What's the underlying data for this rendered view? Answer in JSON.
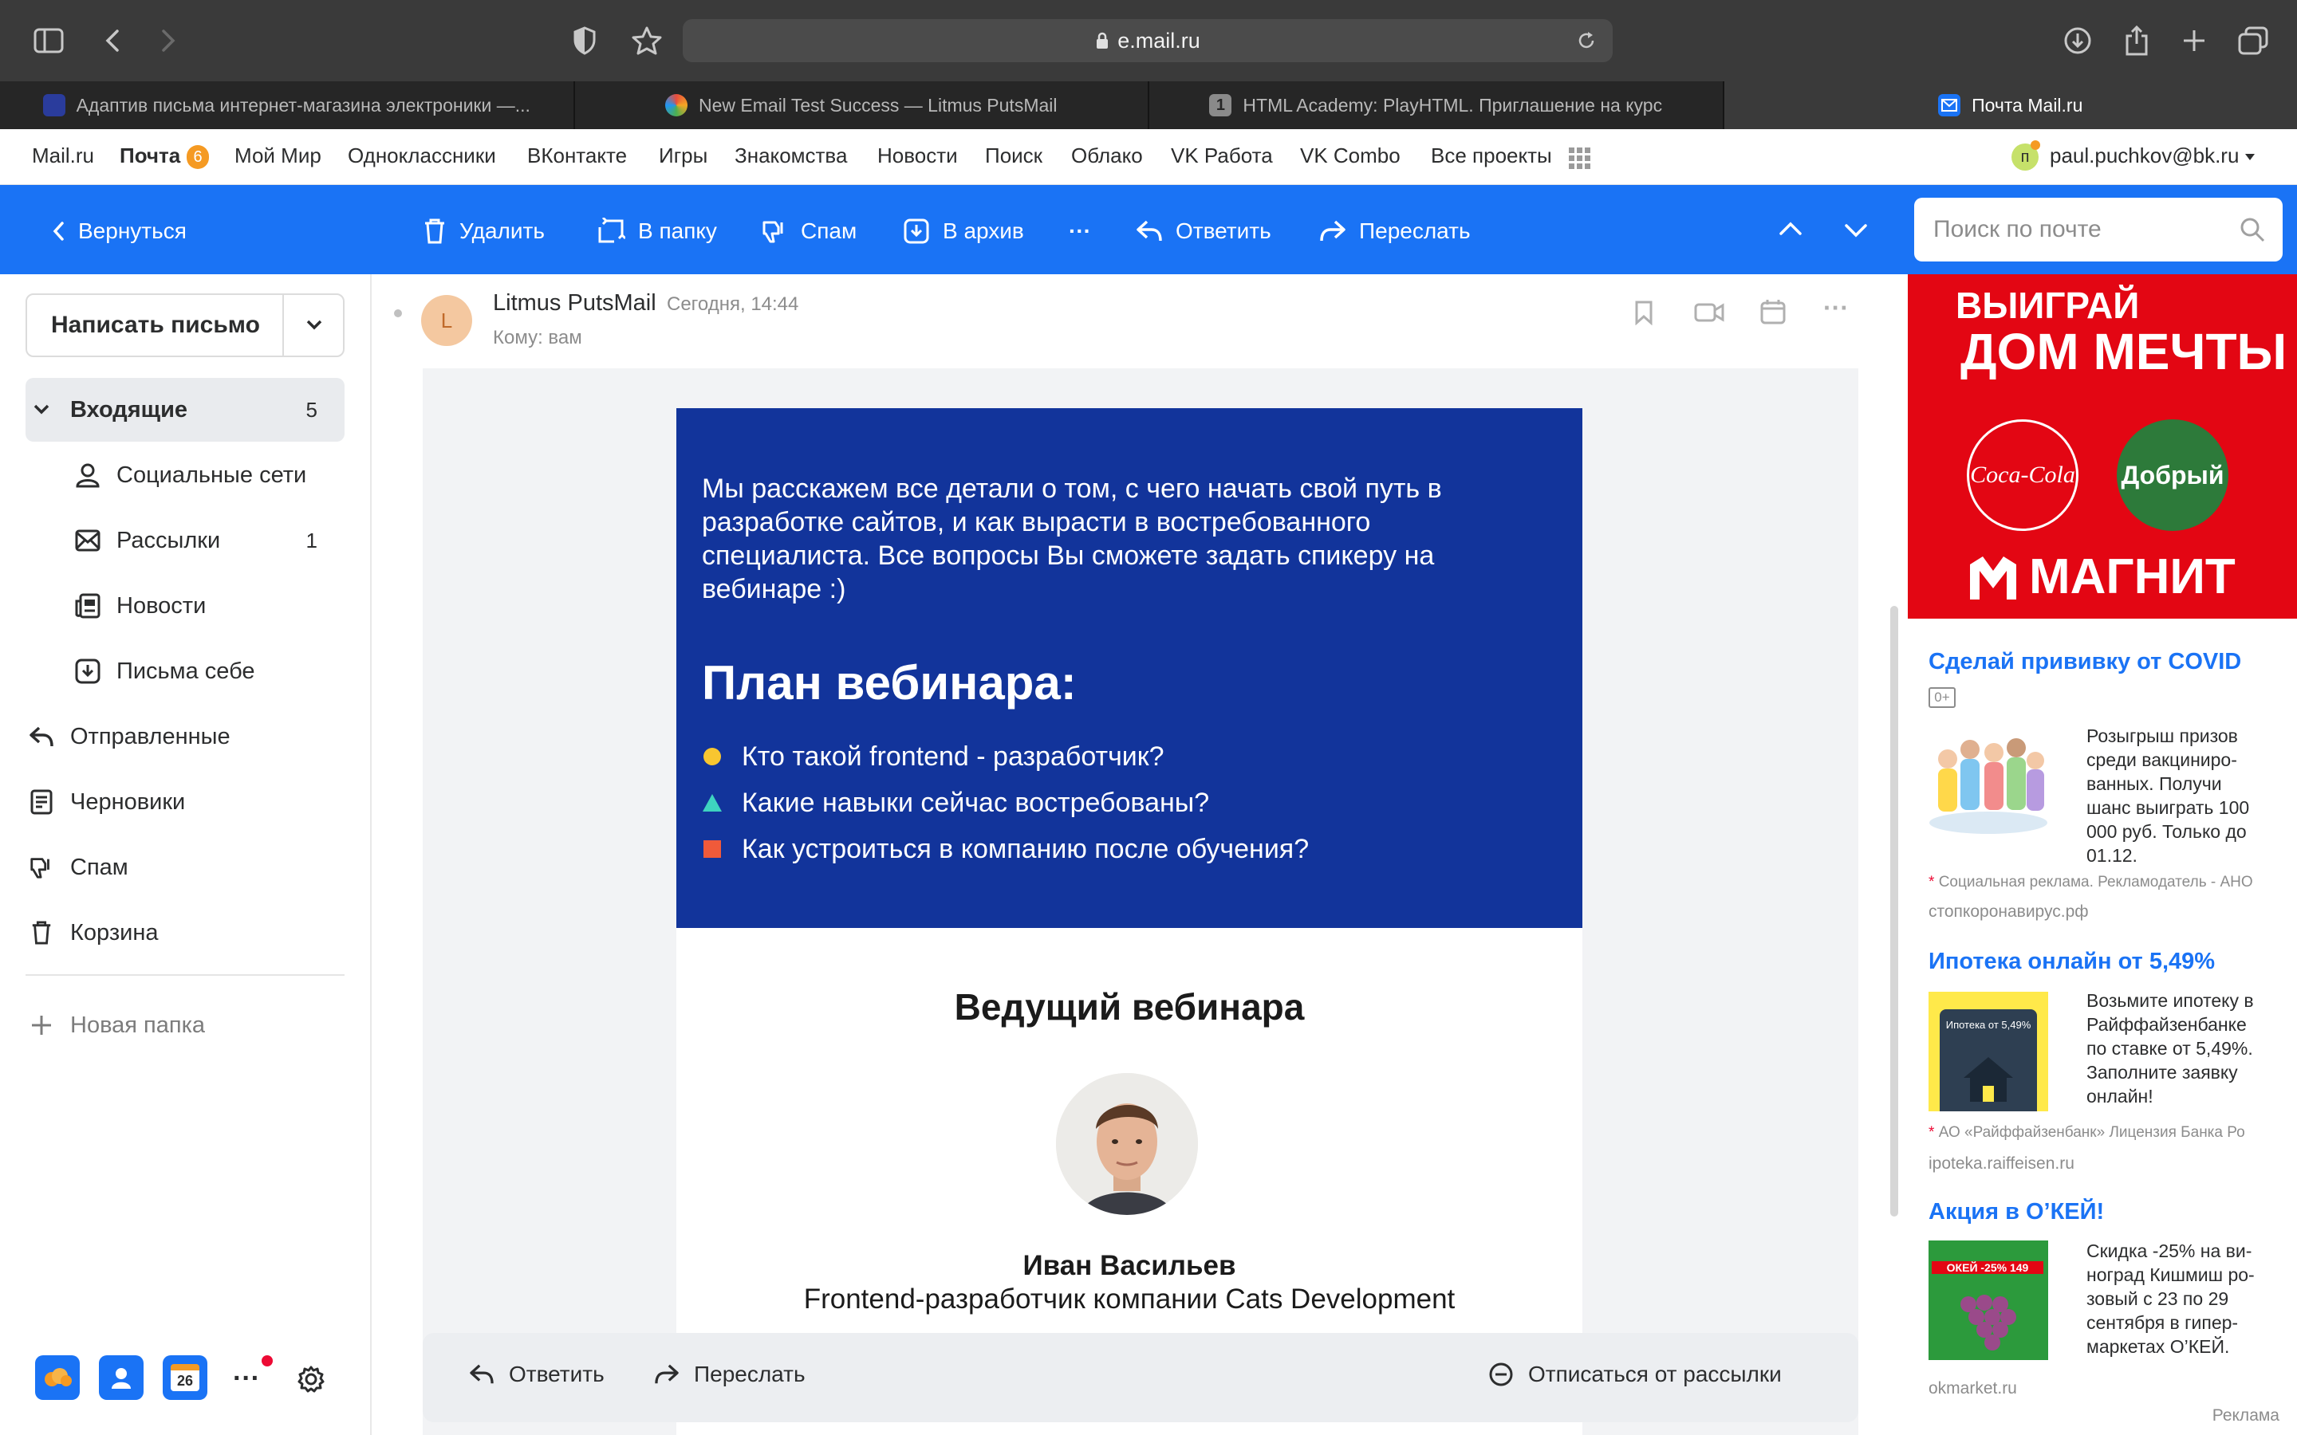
{
  "browser": {
    "url": "e.mail.ru",
    "tabs": [
      {
        "label": "Адаптив письма интернет-магазина электроники —...",
        "active": false
      },
      {
        "label": "New Email Test Success — Litmus PutsMail",
        "active": false
      },
      {
        "label": "HTML Academy: PlayHTML. Приглашение на курс",
        "active": false
      },
      {
        "label": "Почта Mail.ru",
        "active": true
      }
    ],
    "tab3_badge": "1"
  },
  "portal": {
    "links": [
      "Mail.ru",
      "Почта",
      "Мой Мир",
      "Одноклассники",
      "ВКонтакте",
      "Игры",
      "Знакомства",
      "Новости",
      "Поиск",
      "Облако",
      "VK Работа",
      "VK Combo",
      "Все проекты"
    ],
    "mail_badge": "6",
    "user_email": "paul.puchkov@bk.ru",
    "avatar_letter": "п"
  },
  "actionbar": {
    "back": "Вернуться",
    "delete": "Удалить",
    "to_folder": "В папку",
    "spam": "Спам",
    "archive": "В архив",
    "more": "···",
    "reply": "Ответить",
    "forward": "Переслать",
    "search_placeholder": "Поиск по почте"
  },
  "sidebar": {
    "compose": "Написать письмо",
    "inbox": {
      "label": "Входящие",
      "count": "5"
    },
    "subfolders": [
      {
        "label": "Социальные сети",
        "count": ""
      },
      {
        "label": "Рассылки",
        "count": "1"
      },
      {
        "label": "Новости",
        "count": ""
      },
      {
        "label": "Письма себе",
        "count": ""
      }
    ],
    "folders": [
      "Отправленные",
      "Черновики",
      "Спам",
      "Корзина"
    ],
    "new_folder": "Новая папка",
    "calendar_day": "26"
  },
  "message": {
    "sender": "Litmus PutsMail",
    "sender_initial": "L",
    "date": "Сегодня, 14:44",
    "to": "Кому: вам",
    "intro": "Мы расскажем все детали о том, с чего начать свой путь в разработке сайтов, и как вырасти в востребованного специалиста. Все вопросы Вы сможете задать спикеру на вебинаре :)",
    "plan_title": "План вебинара:",
    "plan_items": [
      "Кто такой frontend - разработчик?",
      "Какие навыки сейчас востребованы?",
      "Как устроиться в компанию после обучения?"
    ],
    "host_title": "Ведущий вебинара",
    "host_name": "Иван Васильев",
    "host_role": "Frontend-разработчик компании Cats Development",
    "footer_reply": "Ответить",
    "footer_forward": "Переслать",
    "footer_unsubscribe": "Отписаться от рассылки"
  },
  "ads": {
    "banner": {
      "line1": "ВЫИГРАЙ",
      "line2": "ДОМ МЕЧТЫ",
      "brand1": "Coca-Cola",
      "brand2": "Добрый",
      "brand3": "МАГНИТ"
    },
    "items": [
      {
        "title": "Сделай прививку от COVID",
        "age": "0+",
        "text": "Розыгрыш призов среди вакциниро-ванных. Получи шанс выиграть 100 000 руб. Только до 01.12.",
        "note": "Социальная реклама. Рекламодатель - АНО",
        "host": "стопкоронавирус.рф"
      },
      {
        "title": "Ипотека онлайн от 5,49%",
        "text": "Возьмите ипотеку в Райффайзенбанке по ставке от 5,49%. Заполните заявку онлайн!",
        "note": "АО «Райффайзенбанк» Лицензия Банка Ро",
        "host": "ipoteka.raiffeisen.ru",
        "img_label": "Ипотека от 5,49%"
      },
      {
        "title": "Акция в О’КЕЙ!",
        "text": "Скидка -25% на ви-ноград Кишмиш ро-зовый с 23 по 29 сентября в гипер-маркетах О’КЕЙ.",
        "host": "okmarket.ru",
        "img_label": "ОКЕЙ -25% 149"
      }
    ],
    "ad_label": "Реклама"
  },
  "colors": {
    "accent": "#1a73f5",
    "email_blue": "#12349b",
    "ad_red": "#e30613",
    "bullet_yellow": "#f8c630",
    "bullet_teal": "#3ed3c0",
    "bullet_red": "#f05a3a"
  }
}
